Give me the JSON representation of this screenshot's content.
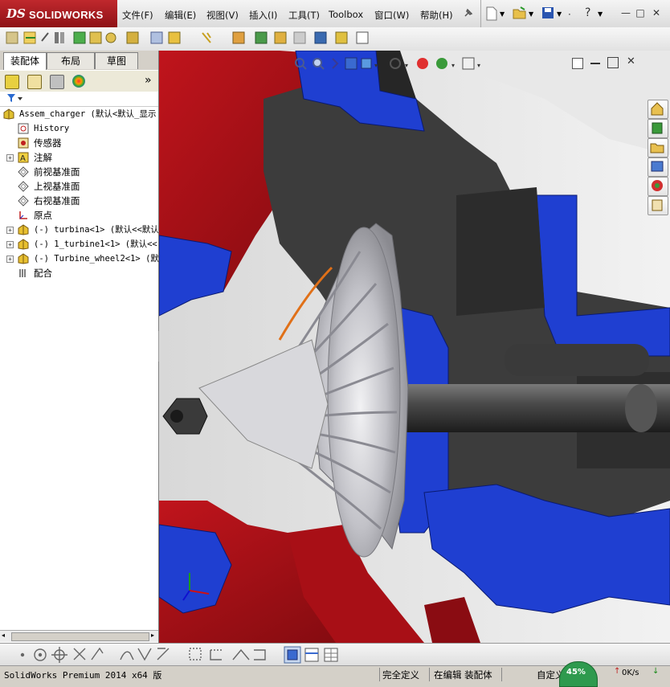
{
  "app": {
    "brand_ds": "DS",
    "brand_name": "SOLIDWORKS"
  },
  "menu": [
    "文件(F)",
    "编辑(E)",
    "视图(V)",
    "插入(I)",
    "工具(T)",
    "Toolbox",
    "窗口(W)",
    "帮助(H)"
  ],
  "left_panel": {
    "tabs": [
      "装配体",
      "布局",
      "草图"
    ],
    "collapse_arrow": "»",
    "tree": [
      {
        "label": "Assem_charger  (默认<默认_显示",
        "mono": true,
        "level": 0,
        "icon": "assembly-icon",
        "expand": false
      },
      {
        "label": "History",
        "mono": true,
        "level": 1,
        "icon": "history-icon",
        "expand": false
      },
      {
        "label": "传感器",
        "mono": false,
        "level": 1,
        "icon": "sensor-icon",
        "expand": false
      },
      {
        "label": "注解",
        "mono": false,
        "level": 1,
        "icon": "annotation-icon",
        "expand": true
      },
      {
        "label": "前视基准面",
        "mono": false,
        "level": 1,
        "icon": "plane-icon",
        "expand": false
      },
      {
        "label": "上视基准面",
        "mono": false,
        "level": 1,
        "icon": "plane-icon",
        "expand": false
      },
      {
        "label": "右视基准面",
        "mono": false,
        "level": 1,
        "icon": "plane-icon",
        "expand": false
      },
      {
        "label": "原点",
        "mono": false,
        "level": 1,
        "icon": "origin-icon",
        "expand": false
      },
      {
        "label": "(-) turbina<1> (默认<<默认",
        "mono": true,
        "level": 1,
        "icon": "part-icon",
        "expand": true
      },
      {
        "label": "(-) 1_turbine1<1> (默认<<",
        "mono": true,
        "level": 1,
        "icon": "part-icon",
        "expand": true
      },
      {
        "label": "(-) Turbine_wheel2<1> (默",
        "mono": true,
        "level": 1,
        "icon": "part-icon",
        "expand": true
      },
      {
        "label": "配合",
        "mono": false,
        "level": 1,
        "icon": "mates-icon",
        "expand": false
      }
    ]
  },
  "status": {
    "version": "SolidWorks Premium 2014 x64 版",
    "definition": "完全定义",
    "editing": "在编辑 装配体",
    "custom": "自定义",
    "progress_percent": "45%",
    "speed": "0K/s"
  },
  "colors": {
    "brand_red": "#b01e23",
    "housing_red": "#b3121a",
    "housing_blue": "#1f3fd1",
    "dark_gray": "#3c3c3c",
    "impeller": "#c8c8cc"
  }
}
